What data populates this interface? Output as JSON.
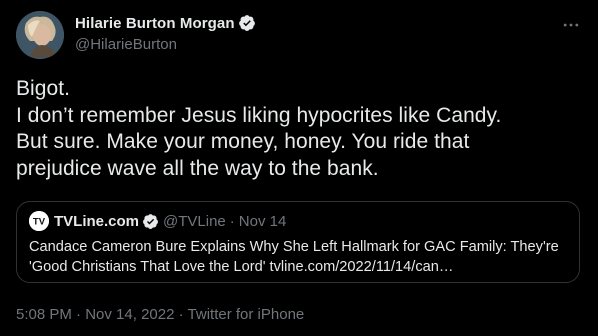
{
  "author": {
    "display_name": "Hilarie Burton Morgan",
    "handle": "@HilarieBurton",
    "verified": true,
    "avatar_icon": "profile-photo"
  },
  "more_icon": "more-horizontal-icon",
  "tweet": {
    "lines": [
      "Bigot.",
      "I don’t remember Jesus liking hypocrites like Candy.",
      "But sure. Make your money, honey. You ride that",
      "prejudice wave all the way to the bank."
    ]
  },
  "quote": {
    "display_name": "TVLine.com",
    "handle": "@TVLine",
    "separator": "·",
    "date": "Nov 14",
    "verified": true,
    "avatar_letters": "TV",
    "lines": [
      "Candace Cameron Bure Explains Why She Left Hallmark for GAC Family: They're",
      "'Good Christians That Love the Lord' tvline.com/2022/11/14/can…"
    ]
  },
  "meta": {
    "time": "5:08 PM",
    "separator": "·",
    "date": "Nov 14, 2022",
    "source": "Twitter for iPhone"
  },
  "colors": {
    "background": "#000000",
    "text": "#e7e9ea",
    "secondary": "#71767b",
    "verified": "#1d9bf0",
    "border": "#2f3336"
  }
}
